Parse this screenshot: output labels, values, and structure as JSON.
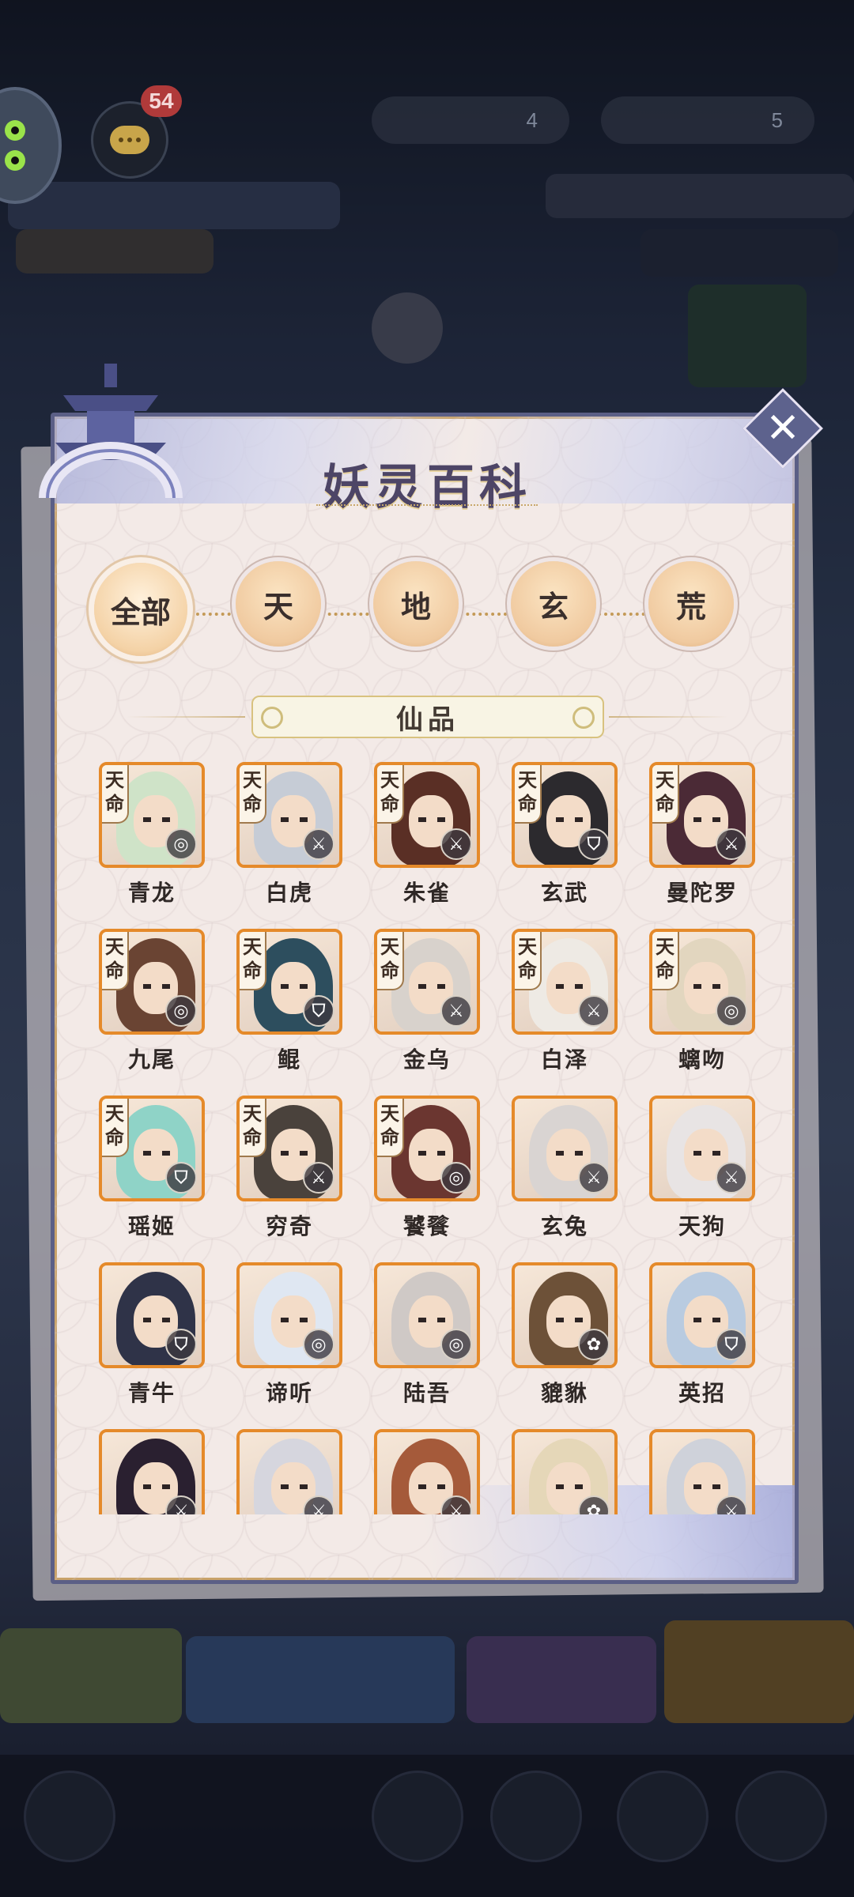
{
  "header": {
    "message_count": "54",
    "resource_1": "4",
    "resource_2": "5"
  },
  "panel": {
    "title": "妖灵百科",
    "close_label": "✕",
    "tabs": [
      {
        "label": "全部",
        "active": true
      },
      {
        "label": "天",
        "active": false
      },
      {
        "label": "地",
        "active": false
      },
      {
        "label": "玄",
        "active": false
      },
      {
        "label": "荒",
        "active": false
      }
    ],
    "section_title": "仙品",
    "tier_tag": [
      "天",
      "命"
    ],
    "characters": [
      {
        "name": "青龙",
        "tagged": true,
        "role": "roundel-icon",
        "hair": "#cfe3c8"
      },
      {
        "name": "白虎",
        "tagged": true,
        "role": "swords-icon",
        "hair": "#c6ccd6"
      },
      {
        "name": "朱雀",
        "tagged": true,
        "role": "swords-icon",
        "hair": "#5a2f25"
      },
      {
        "name": "玄武",
        "tagged": true,
        "role": "shield-icon",
        "hair": "#2c2a2e"
      },
      {
        "name": "曼陀罗",
        "tagged": true,
        "role": "swords-icon",
        "hair": "#4b2a36"
      },
      {
        "name": "九尾",
        "tagged": true,
        "role": "roundel-icon",
        "hair": "#6a4433"
      },
      {
        "name": "鲲",
        "tagged": true,
        "role": "shield-icon",
        "hair": "#2d4e5e"
      },
      {
        "name": "金乌",
        "tagged": true,
        "role": "swords-icon",
        "hair": "#d8d2cc"
      },
      {
        "name": "白泽",
        "tagged": true,
        "role": "swords-icon",
        "hair": "#eeeae4"
      },
      {
        "name": "螭吻",
        "tagged": true,
        "role": "roundel-icon",
        "hair": "#e2d6bf"
      },
      {
        "name": "瑶姬",
        "tagged": true,
        "role": "shield-icon",
        "hair": "#8fd3c7"
      },
      {
        "name": "穷奇",
        "tagged": true,
        "role": "swords-icon",
        "hair": "#4a423c"
      },
      {
        "name": "饕餮",
        "tagged": true,
        "role": "roundel-icon",
        "hair": "#6b3630"
      },
      {
        "name": "玄兔",
        "tagged": false,
        "role": "swords-icon",
        "hair": "#d9d4d2"
      },
      {
        "name": "天狗",
        "tagged": false,
        "role": "swords-icon",
        "hair": "#e8e4e4"
      },
      {
        "name": "青牛",
        "tagged": false,
        "role": "shield-icon",
        "hair": "#2f3348"
      },
      {
        "name": "谛听",
        "tagged": false,
        "role": "roundel-icon",
        "hair": "#dfe7f2"
      },
      {
        "name": "陆吾",
        "tagged": false,
        "role": "roundel-icon",
        "hair": "#cfc9c6"
      },
      {
        "name": "貔貅",
        "tagged": false,
        "role": "lotus-icon",
        "hair": "#6d5138"
      },
      {
        "name": "英招",
        "tagged": false,
        "role": "shield-icon",
        "hair": "#b9cbe0"
      },
      {
        "name": "",
        "tagged": false,
        "role": "swords-icon",
        "hair": "#2a2030"
      },
      {
        "name": "",
        "tagged": false,
        "role": "swords-icon",
        "hair": "#d6d6de"
      },
      {
        "name": "",
        "tagged": false,
        "role": "swords-icon",
        "hair": "#a55a3a"
      },
      {
        "name": "",
        "tagged": false,
        "role": "lotus-icon",
        "hair": "#e5d7b8"
      },
      {
        "name": "",
        "tagged": false,
        "role": "swords-icon",
        "hair": "#cfd2da"
      }
    ]
  }
}
